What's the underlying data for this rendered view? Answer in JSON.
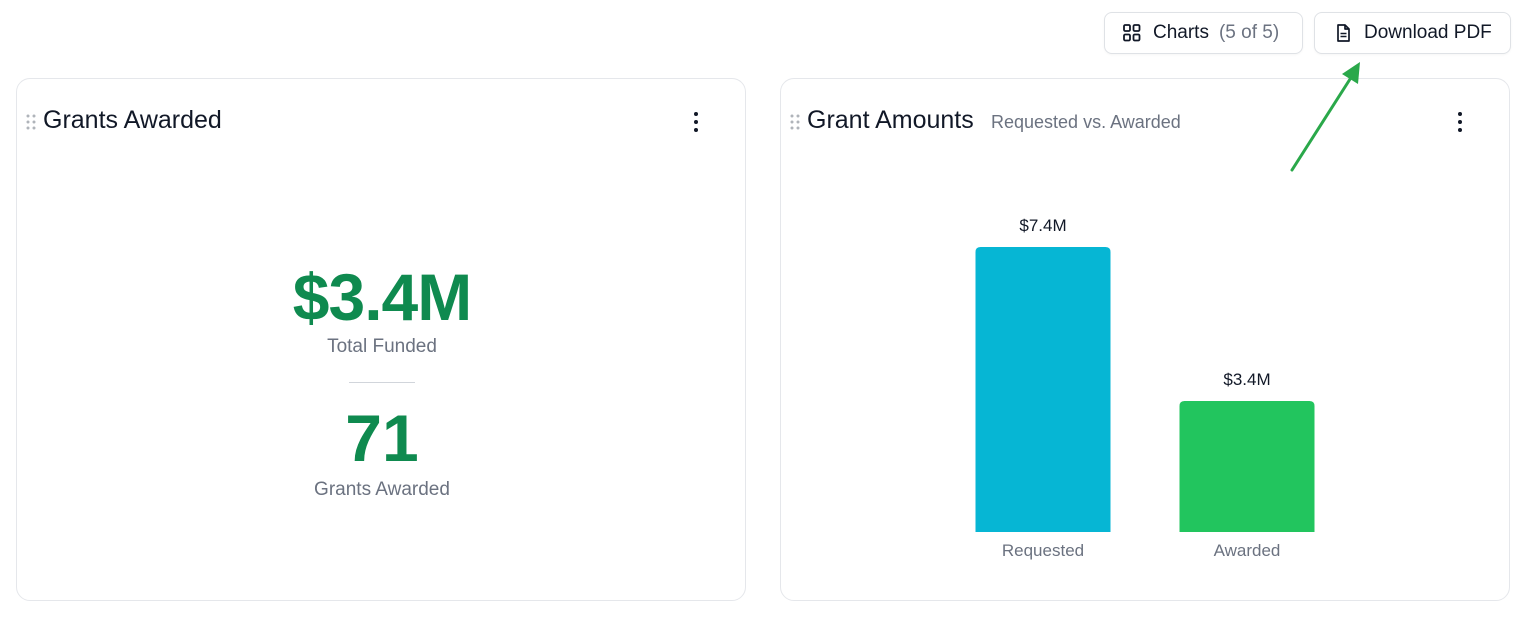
{
  "toolbar": {
    "charts_label": "Charts",
    "charts_count": "(5 of 5)",
    "charts_icon": "grid-icon",
    "pdf_label": "Download PDF",
    "pdf_icon": "document-icon"
  },
  "cards": {
    "grants_awarded": {
      "title": "Grants Awarded",
      "total_funded_value": "$3.4M",
      "total_funded_label": "Total Funded",
      "grants_count_value": "71",
      "grants_count_label": "Grants Awarded"
    },
    "grant_amounts": {
      "title": "Grant Amounts",
      "subtitle": "Requested vs. Awarded"
    }
  },
  "chart_data": {
    "type": "bar",
    "categories": [
      "Requested",
      "Awarded"
    ],
    "values": [
      7.4,
      3.4
    ],
    "value_labels": [
      "$7.4M",
      "$3.4M"
    ],
    "colors": [
      "#06b6d4",
      "#22c55e"
    ],
    "ylim": [
      0,
      7.4
    ],
    "grid": false
  },
  "colors": {
    "kpi": "#0f8a4f",
    "annotation_arrow": "#2aa84a"
  }
}
